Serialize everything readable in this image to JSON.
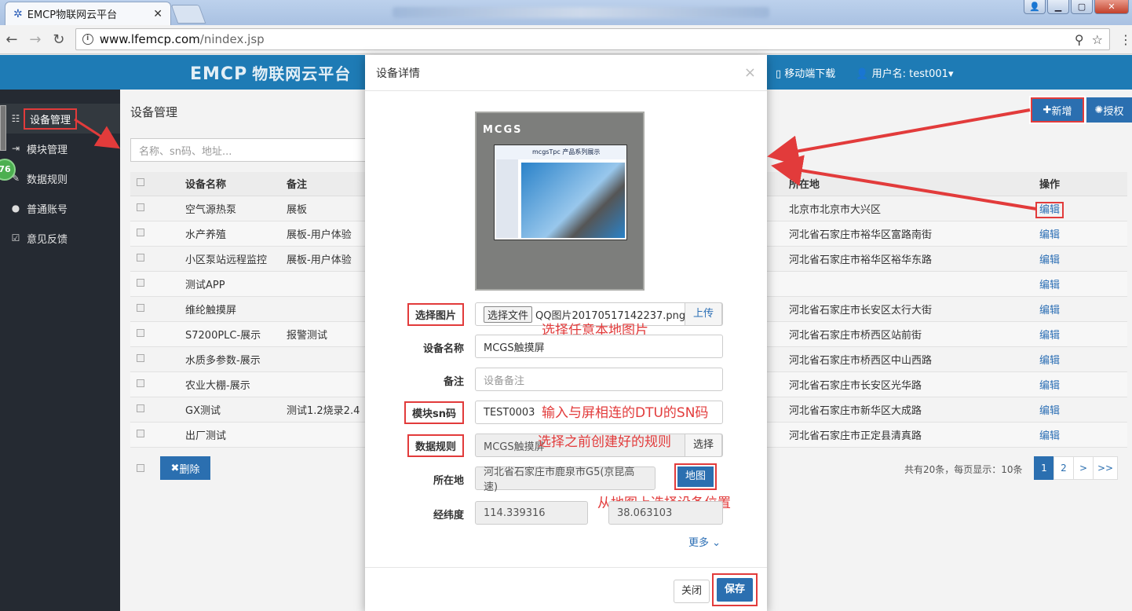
{
  "browser": {
    "tab_title": "EMCP物联网云平台",
    "url_host": "www.lfemcp.com",
    "url_path": "/nindex.jsp",
    "icons": [
      "back-icon",
      "forward-icon",
      "reload-icon",
      "info-icon",
      "zoom-icon",
      "star-icon",
      "menu-icon",
      "close-icon"
    ]
  },
  "topnav": {
    "brand_latin": "EMCP",
    "brand_cn": "物联网云平台",
    "mobile_download": "移动端下载",
    "username": "用户名: test001"
  },
  "sidebar": {
    "badge": "76",
    "items": [
      {
        "label": "设备管理",
        "icon": "grid-icon",
        "active": true
      },
      {
        "label": "模块管理",
        "icon": "sign-in-icon"
      },
      {
        "label": "数据规则",
        "icon": "edit-icon"
      },
      {
        "label": "普通账号",
        "icon": "user-icon"
      },
      {
        "label": "意见反馈",
        "icon": "feedback-icon"
      }
    ]
  },
  "main": {
    "title": "设备管理",
    "add_label": "新增",
    "auth_label": "授权",
    "search_placeholder": "名称、sn码、地址...",
    "columns": {
      "name": "设备名称",
      "remark": "备注",
      "location": "所在地",
      "action": "操作"
    },
    "rows": [
      {
        "name": "空气源热泵",
        "remark": "展板",
        "location": "北京市北京市大兴区",
        "action": "编辑"
      },
      {
        "name": "水产养殖",
        "remark": "展板-用户体验",
        "location": "河北省石家庄市裕华区富路南街",
        "action": "编辑"
      },
      {
        "name": "小区泵站远程监控",
        "remark": "展板-用户体验",
        "location": "河北省石家庄市裕华区裕华东路",
        "action": "编辑"
      },
      {
        "name": "测试APP",
        "remark": "",
        "location": "",
        "action": "编辑"
      },
      {
        "name": "维纶触摸屏",
        "remark": "",
        "location": "河北省石家庄市长安区太行大街",
        "action": "编辑"
      },
      {
        "name": "S7200PLC-展示",
        "remark": "报警测试",
        "location": "河北省石家庄市桥西区站前街",
        "action": "编辑"
      },
      {
        "name": "水质多参数-展示",
        "remark": "",
        "location": "河北省石家庄市桥西区中山西路",
        "action": "编辑"
      },
      {
        "name": "农业大棚-展示",
        "remark": "",
        "location": "河北省石家庄市长安区光华路",
        "action": "编辑"
      },
      {
        "name": "GX测试",
        "remark": "测试1.2烧录2.4",
        "location": "河北省石家庄市新华区大成路",
        "action": "编辑"
      },
      {
        "name": "出厂测试",
        "remark": "",
        "location": "河北省石家庄市正定县清真路",
        "action": "编辑"
      }
    ],
    "delete_label": "删除",
    "pager_info": "共有20条，每页显示：10条",
    "pages": [
      "1",
      "2",
      ">",
      ">>"
    ]
  },
  "modal": {
    "title": "设备详情",
    "close_x": "×",
    "image_brand": "MCGS",
    "image_header": "mcgsTpc 产品系列展示",
    "fields": {
      "image_label": "选择图片",
      "file_button": "选择文件",
      "file_name": "QQ图片20170517142237.png",
      "upload": "上传",
      "name_label": "设备名称",
      "name_value": "MCGS触摸屏",
      "remark_label": "备注",
      "remark_placeholder": "设备备注",
      "sn_label": "模块sn码",
      "sn_value": "TEST0003",
      "rule_label": "数据规则",
      "rule_value": "MCGS触摸屏",
      "rule_choose": "选择",
      "location_label": "所在地",
      "location_value": "河北省石家庄市鹿泉市G5(京昆高速)",
      "map_button": "地图",
      "coords_label": "经纬度",
      "longitude": "114.339316",
      "latitude": "38.063103"
    },
    "more": "更多",
    "close_button": "关闭",
    "save_button": "保存"
  },
  "annotations": {
    "image_hint": "选择任意本地图片",
    "sn_hint": "输入与屏相连的DTU的SN码",
    "rule_hint": "选择之前创建好的规则",
    "map_hint": "从地图上选择设备位置"
  },
  "colors": {
    "annotation_red": "#e23b3b",
    "primary_blue": "#2b6fb0",
    "topnav_blue": "#1e7bb5",
    "sidebar_dark": "#252a32"
  }
}
